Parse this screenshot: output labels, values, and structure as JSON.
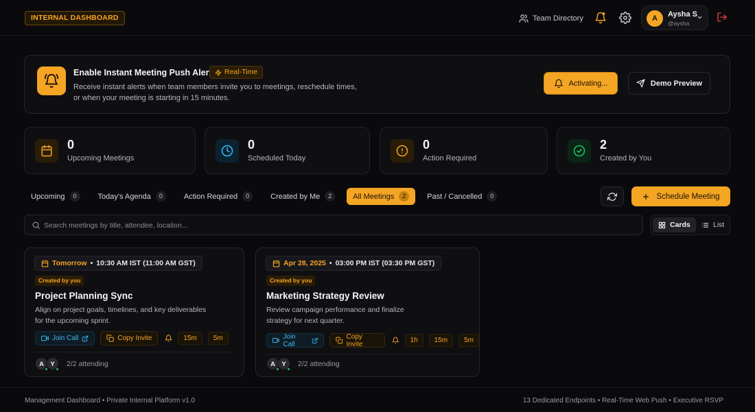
{
  "header": {
    "brand": "INTERNAL DASHBOARD",
    "team_directory": "Team Directory",
    "user": {
      "initial": "A",
      "name": "Aysha S",
      "handle": "@aysha"
    }
  },
  "banner": {
    "title": "Enable Instant Meeting Push Alerts",
    "badge": "Real-Time",
    "description": "Receive instant alerts when team members invite you to meetings, reschedule times, or when your meeting is starting in 15 minutes.",
    "activate_label": "Activating...",
    "demo_label": "Demo Preview"
  },
  "stats": [
    {
      "value": "0",
      "label": "Upcoming Meetings",
      "icon": "calendar-icon",
      "color": "#f5a524"
    },
    {
      "value": "0",
      "label": "Scheduled Today",
      "icon": "clock-icon",
      "color": "#38bdf8"
    },
    {
      "value": "0",
      "label": "Action Required",
      "icon": "alert-circle-icon",
      "color": "#f5a524"
    },
    {
      "value": "2",
      "label": "Created by You",
      "icon": "check-circle-icon",
      "color": "#22c55e"
    }
  ],
  "tabs": [
    {
      "label": "Upcoming",
      "count": "0"
    },
    {
      "label": "Today's Agenda",
      "count": "0"
    },
    {
      "label": "Action Required",
      "count": "0"
    },
    {
      "label": "Created by Me",
      "count": "2"
    },
    {
      "label": "All Meetings",
      "count": "2",
      "active": true
    },
    {
      "label": "Past / Cancelled",
      "count": "0"
    }
  ],
  "schedule_label": "Schedule Meeting",
  "search": {
    "placeholder": "Search meetings by title, attendee, location..."
  },
  "view": {
    "cards": "Cards",
    "list": "List"
  },
  "meetings": [
    {
      "day": "Tomorrow",
      "time": "10:30 AM IST (11:00 AM GST)",
      "badge": "Created by you",
      "title": "Project Planning Sync",
      "description": "Align on project goals, timelines, and key deliverables for the upcoming sprint.",
      "join": "Join Call",
      "copy": "Copy Invite",
      "reminders": [
        "15m",
        "5m"
      ],
      "attendees": [
        "A",
        "Y"
      ],
      "attending": "2/2 attending"
    },
    {
      "day": "Apr 28, 2025",
      "time": "03:00 PM IST (03:30 PM GST)",
      "badge": "Created by you",
      "title": "Marketing Strategy Review",
      "description": "Review campaign performance and finalize strategy for next quarter.",
      "join": "Join Call",
      "copy": "Copy Invite",
      "reminders": [
        "1h",
        "15m",
        "5m"
      ],
      "attendees": [
        "A",
        "Y"
      ],
      "attending": "2/2 attending"
    }
  ],
  "footer": {
    "left": "Management Dashboard • Private Internal Platform v1.0",
    "right": "13 Dedicated Endpoints • Real-Time Web Push • Executive RSVP"
  },
  "colors": {
    "accent": "#f5a524",
    "background": "#0a0a0c",
    "join": "#3fb9e8",
    "online": "#22c55e",
    "logout": "#ef4444"
  }
}
